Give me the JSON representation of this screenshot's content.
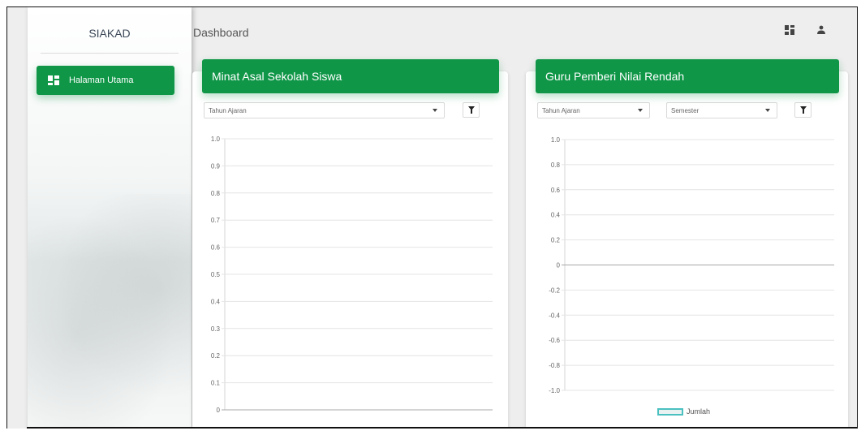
{
  "app": {
    "brand": "SIAKAD",
    "page_title": "Dashboard"
  },
  "sidebar": {
    "items": [
      {
        "label": "Halaman Utama",
        "icon": "dashboard-icon",
        "active": true
      }
    ]
  },
  "topbar": {
    "icons": [
      "dashboard-icon",
      "person-icon"
    ]
  },
  "colors": {
    "accent": "#0f9647",
    "legend": "#4bc0c0"
  },
  "cards": {
    "left": {
      "title": "Minat Asal Sekolah Siswa",
      "filter": {
        "tahun_ajaran": "Tahun Ajaran"
      }
    },
    "right": {
      "title": "Guru Pemberi Nilai Rendah",
      "filter": {
        "tahun_ajaran": "Tahun Ajaran",
        "semester": "Semester"
      },
      "legend": "Jumlah"
    }
  },
  "chart_data": [
    {
      "type": "bar",
      "title": "Minat Asal Sekolah Siswa",
      "categories": [],
      "series": [],
      "ylim": [
        0,
        1.0
      ],
      "yticks": [
        "1.0",
        "0.9",
        "0.8",
        "0.7",
        "0.6",
        "0.5",
        "0.4",
        "0.3",
        "0.2",
        "0.1",
        "0"
      ],
      "grid": true
    },
    {
      "type": "bar",
      "title": "Guru Pemberi Nilai Rendah",
      "categories": [],
      "series": [
        {
          "name": "Jumlah",
          "values": []
        }
      ],
      "ylim": [
        -1.0,
        1.0
      ],
      "yticks": [
        "1.0",
        "0.8",
        "0.6",
        "0.4",
        "0.2",
        "0",
        "-0.2",
        "-0.4",
        "-0.6",
        "-0.8",
        "-1.0"
      ],
      "grid": true,
      "legend_position": "bottom"
    }
  ]
}
